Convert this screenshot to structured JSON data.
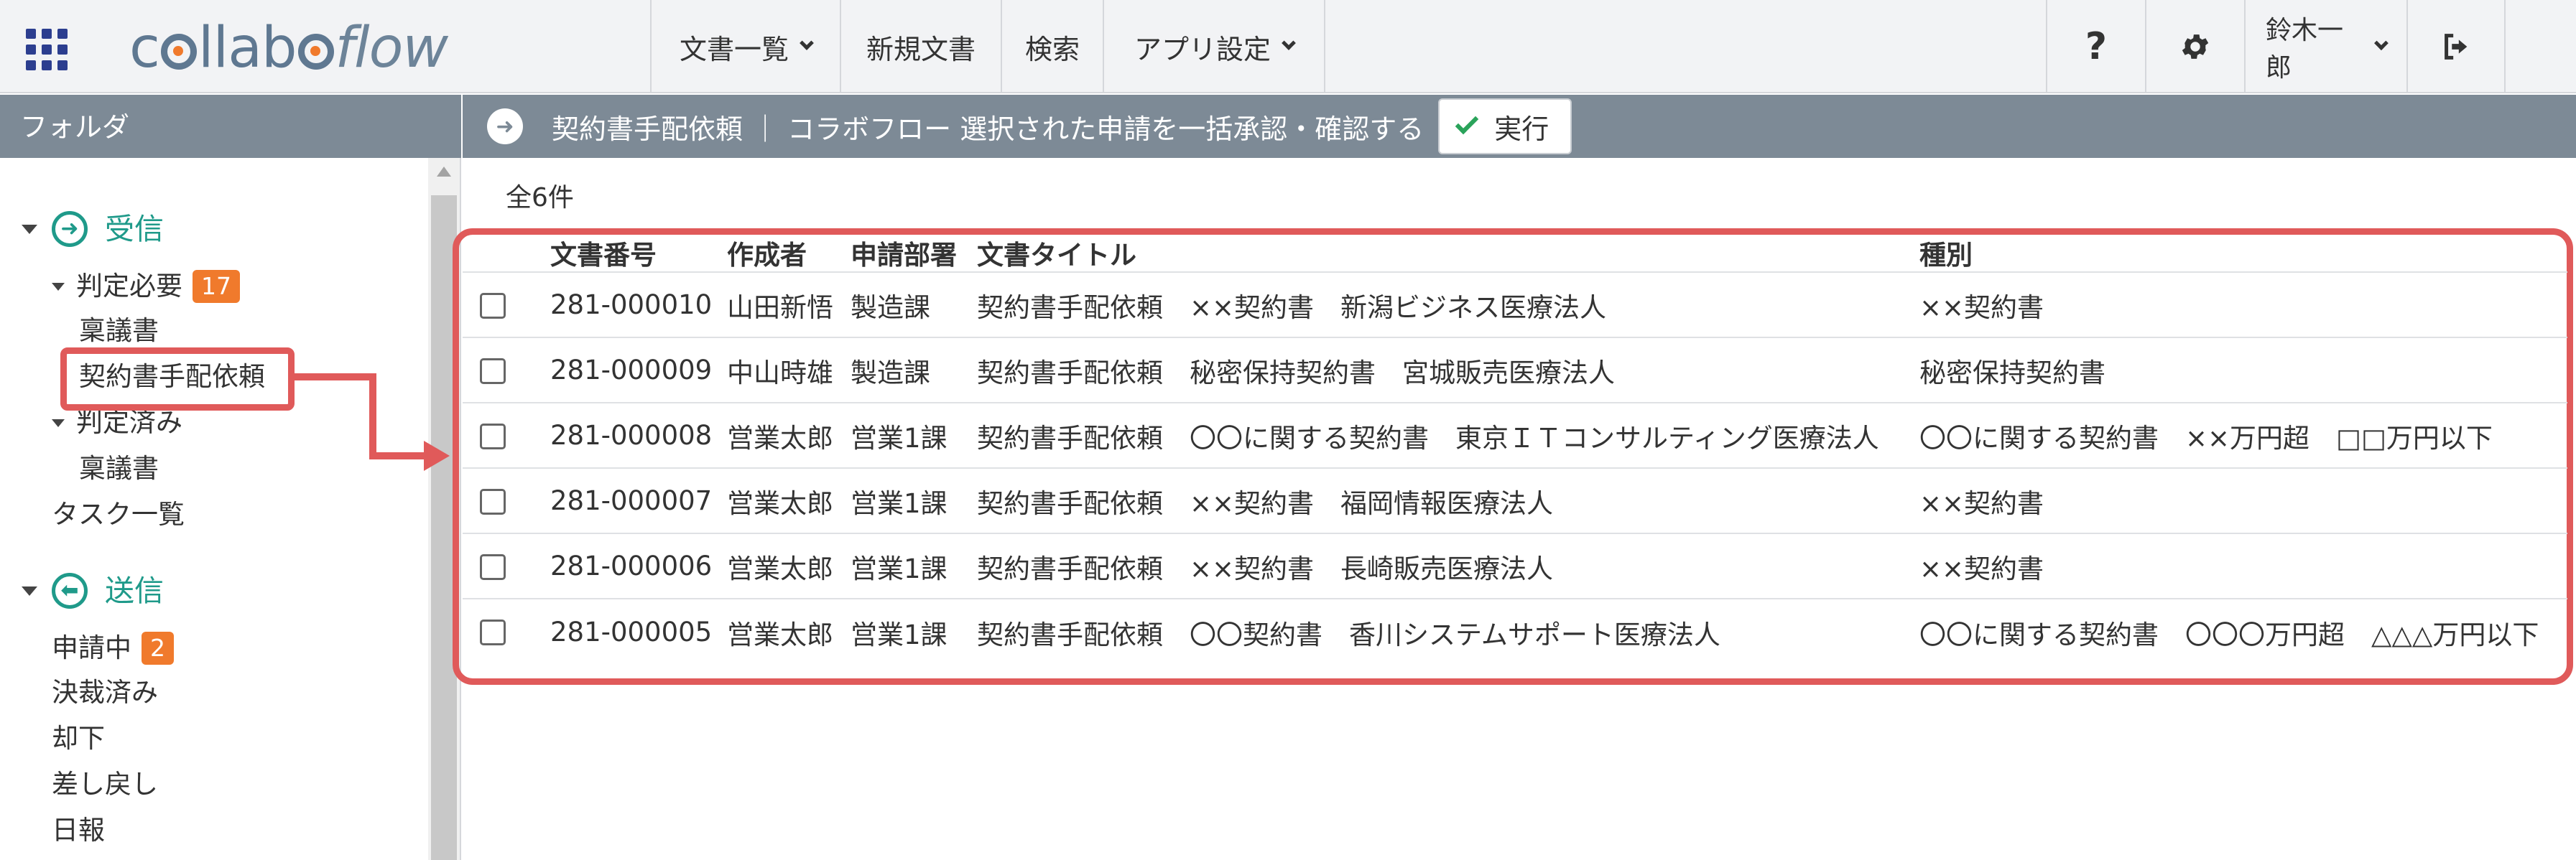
{
  "header": {
    "logo": "collaboflow",
    "nav": [
      {
        "label": "文書一覧",
        "caret": true
      },
      {
        "label": "新規文書",
        "caret": false
      },
      {
        "label": "検索",
        "caret": false
      },
      {
        "label": "アプリ設定",
        "caret": true
      }
    ],
    "help_icon": "?",
    "user": "鈴木一郎",
    "icons": [
      "apps-grid-icon",
      "help-icon",
      "gear-icon",
      "logout-icon"
    ]
  },
  "sidebar": {
    "title": "フォルダ",
    "inbox": {
      "label": "受信",
      "judge_needed": {
        "label": "判定必要",
        "badge": "17"
      },
      "items1": [
        "稟議書",
        "契約書手配依頼"
      ],
      "judged": {
        "label": "判定済み"
      },
      "items2": [
        "稟議書"
      ],
      "task_list": "タスク一覧"
    },
    "outbox": {
      "label": "送信",
      "pending": {
        "label": "申請中",
        "badge": "2"
      },
      "items": [
        "決裁済み",
        "却下",
        "差し戻し",
        "日報"
      ]
    }
  },
  "action_bar": {
    "text": "契約書手配依頼 ｜ コラボフロー 選択された申請を一括承認・確認する",
    "execute_label": "実行"
  },
  "table": {
    "count": "全6件",
    "columns": [
      "文書番号",
      "作成者",
      "申請部署",
      "文書タイトル",
      "種別"
    ],
    "rows": [
      {
        "num": "281-000010",
        "author": "山田新悟",
        "dept": "製造課",
        "title": "契約書手配依頼　××契約書　新潟ビジネス医療法人",
        "kind": "××契約書"
      },
      {
        "num": "281-000009",
        "author": "中山時雄",
        "dept": "製造課",
        "title": "契約書手配依頼　秘密保持契約書　宮城販売医療法人",
        "kind": "秘密保持契約書"
      },
      {
        "num": "281-000008",
        "author": "営業太郎",
        "dept": "営業1課",
        "title": "契約書手配依頼　〇〇に関する契約書　東京ＩＴコンサルティング医療法人",
        "kind": "〇〇に関する契約書　××万円超　□□万円以下"
      },
      {
        "num": "281-000007",
        "author": "営業太郎",
        "dept": "営業1課",
        "title": "契約書手配依頼　××契約書　福岡情報医療法人",
        "kind": "××契約書"
      },
      {
        "num": "281-000006",
        "author": "営業太郎",
        "dept": "営業1課",
        "title": "契約書手配依頼　××契約書　長崎販売医療法人",
        "kind": "××契約書"
      },
      {
        "num": "281-000005",
        "author": "営業太郎",
        "dept": "営業1課",
        "title": "契約書手配依頼　〇〇契約書　香川システムサポート医療法人",
        "kind": "〇〇に関する契約書　〇〇〇万円超　△△△万円以下"
      }
    ]
  },
  "colors": {
    "accent": "#1f9a8a",
    "badge": "#f07a2c",
    "highlight": "#e05a5a",
    "bar": "#7d8a96"
  }
}
